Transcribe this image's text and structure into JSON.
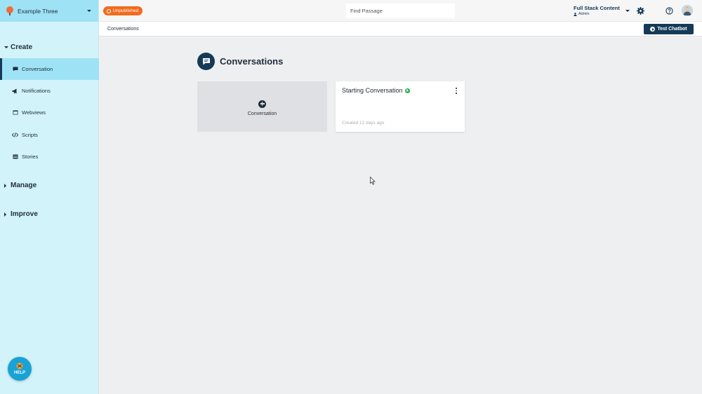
{
  "project": {
    "name": "Example Three"
  },
  "status_badge": {
    "label": "Unpublished",
    "color": "#f26b1d"
  },
  "search": {
    "placeholder": "Find Passage",
    "value": ""
  },
  "account": {
    "org": "Full Stack Content",
    "role": "Admin"
  },
  "sidebar": {
    "sections": [
      {
        "label": "Create",
        "expanded": true
      },
      {
        "label": "Manage",
        "expanded": false
      },
      {
        "label": "Improve",
        "expanded": false
      }
    ],
    "items": [
      {
        "label": "Conversation",
        "icon": "chat-icon",
        "active": true
      },
      {
        "label": "Notifications",
        "icon": "megaphone-icon",
        "active": false
      },
      {
        "label": "Webviews",
        "icon": "window-icon",
        "active": false
      },
      {
        "label": "Scripts",
        "icon": "code-icon",
        "active": false
      },
      {
        "label": "Stories",
        "icon": "card-icon",
        "active": false
      }
    ],
    "help_label": "HELP"
  },
  "breadcrumb": {
    "current": "Conversations"
  },
  "test_button": {
    "label": "Test Chatbot"
  },
  "page": {
    "title": "Conversations",
    "add_card_label": "Conversation",
    "cards": [
      {
        "title": "Starting Conversation",
        "created": "Created 12 days ago",
        "live": true
      }
    ]
  },
  "colors": {
    "accent": "#143a57",
    "sidebar_bg": "#d2f3fa",
    "active_bg": "#9ee3f5",
    "live": "#23b24a"
  }
}
